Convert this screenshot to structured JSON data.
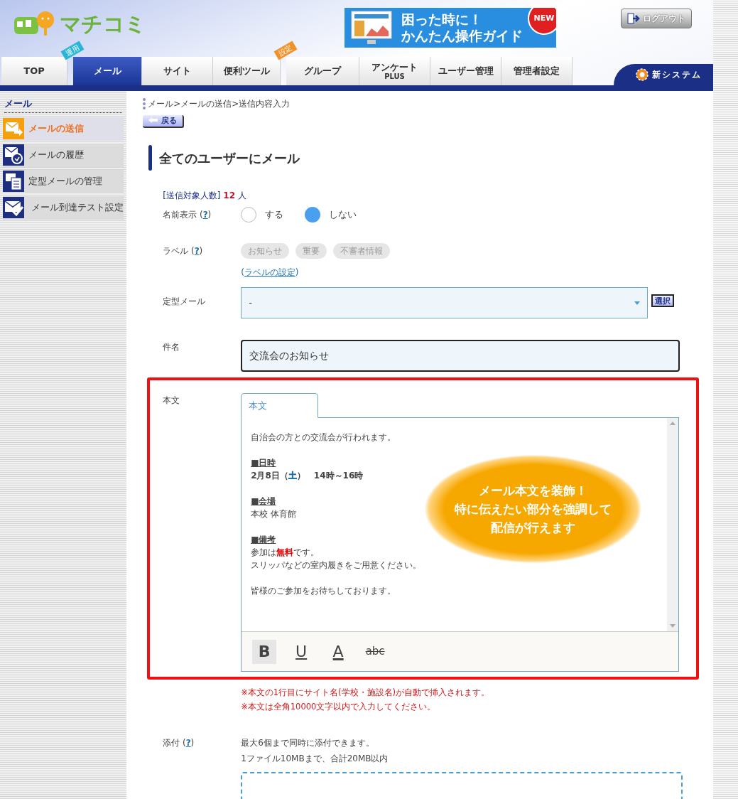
{
  "header": {
    "logo_text": "マチコミ",
    "banner": {
      "line_1": "困った時に！",
      "line_2": "かんたん操作ガイド",
      "badge": "NEW"
    },
    "logout": "ログアウト"
  },
  "nav": {
    "tabs": [
      {
        "label": "TOP",
        "selected": false
      },
      {
        "label": "メール",
        "tag": "運用",
        "selected": true
      },
      {
        "label": "サイト",
        "selected": false
      },
      {
        "label": "便利ツール",
        "selected": false
      },
      {
        "label": "グループ",
        "tag": "設定",
        "selected": false
      },
      {
        "label": "アンケート",
        "sublabel": "PLUS",
        "selected": false
      },
      {
        "label": "ユーザー管理",
        "selected": false
      },
      {
        "label": "管理者設定",
        "selected": false
      }
    ],
    "new_system": "新システム"
  },
  "sidebar": {
    "heading": "メール",
    "items": [
      {
        "label": "メールの送信",
        "selected": true
      },
      {
        "label": "メールの履歴",
        "selected": false
      },
      {
        "label": "定型メールの管理",
        "selected": false
      },
      {
        "label": " メール到達テスト設定",
        "selected": false
      }
    ]
  },
  "breadcrumb": "メール>メールの送信>送信内容入力",
  "back_button": "戻る",
  "title": "全てのユーザーにメール",
  "recipients": {
    "label": "[送信対象人数]",
    "count": "12",
    "unit": "人"
  },
  "name_display": {
    "label": "名前表示",
    "help": {
      "open": "(",
      "mark": "?",
      "close": ")"
    },
    "options": [
      {
        "label": "する",
        "selected": false
      },
      {
        "label": "しない",
        "selected": true
      }
    ]
  },
  "labels": {
    "label": "ラベル",
    "help": {
      "open": "(",
      "mark": "?",
      "close": ")"
    },
    "tags": [
      "お知らせ",
      "重要",
      "不審者情報"
    ],
    "settings_link": {
      "before": "(",
      "link": "ラベルの設定",
      "after": ")"
    }
  },
  "template": {
    "label": "定型メール",
    "value": "-",
    "button": "選択"
  },
  "subject": {
    "label": "件名",
    "value": "交流会のお知らせ"
  },
  "body": {
    "label": "本文",
    "tab": "本文",
    "paragraphs": [
      [
        {
          "kind": "plain",
          "segments": [
            {
              "text": "自治会の方との交流会が行われます。"
            }
          ]
        }
      ],
      [
        {
          "kind": "heading",
          "segments": [
            {
              "text": "■日時"
            }
          ]
        },
        {
          "kind": "bold",
          "segments": [
            {
              "text": "2月8日（"
            },
            {
              "text": "土",
              "color": "#1a6fb0"
            },
            {
              "text": "）　14時～16時"
            }
          ]
        }
      ],
      [
        {
          "kind": "heading",
          "segments": [
            {
              "text": "■会場"
            }
          ]
        },
        {
          "kind": "plain",
          "segments": [
            {
              "text": "本校 体育館"
            }
          ]
        }
      ],
      [
        {
          "kind": "heading",
          "segments": [
            {
              "text": "■備考"
            }
          ]
        },
        {
          "kind": "plain",
          "segments": [
            {
              "text": "参加は"
            },
            {
              "text": "無料",
              "color": "#dd0000"
            },
            {
              "text": "です。"
            }
          ]
        },
        {
          "kind": "plain",
          "segments": [
            {
              "text": "スリッパなどの室内履きをご用意ください。"
            }
          ]
        }
      ],
      [
        {
          "kind": "plain",
          "segments": [
            {
              "text": "皆様のご参加をお待ちしております。"
            }
          ]
        }
      ]
    ],
    "toolbar": [
      {
        "kind": "bold",
        "label": "B",
        "selected": true
      },
      {
        "kind": "underline",
        "label": "U",
        "selected": false
      },
      {
        "kind": "color",
        "label": "A",
        "selected": false
      },
      {
        "kind": "strike",
        "label": "abc",
        "selected": false
      }
    ],
    "callout": [
      "メール本文を装飾！",
      "特に伝えたい部分を強調して",
      "配信が行えます"
    ]
  },
  "notes": [
    "※本文の1行目にサイト名(学校・施設名)が自動で挿入されます。",
    "※本文は全角10000文字以内で入力してください。"
  ],
  "attachment": {
    "label": "添付",
    "help": {
      "open": "(",
      "mark": "?",
      "close": ")"
    },
    "lines": [
      "最大6個まで同時に添付できます。",
      "1ファイル10MBまで、合計20MB以内"
    ]
  }
}
